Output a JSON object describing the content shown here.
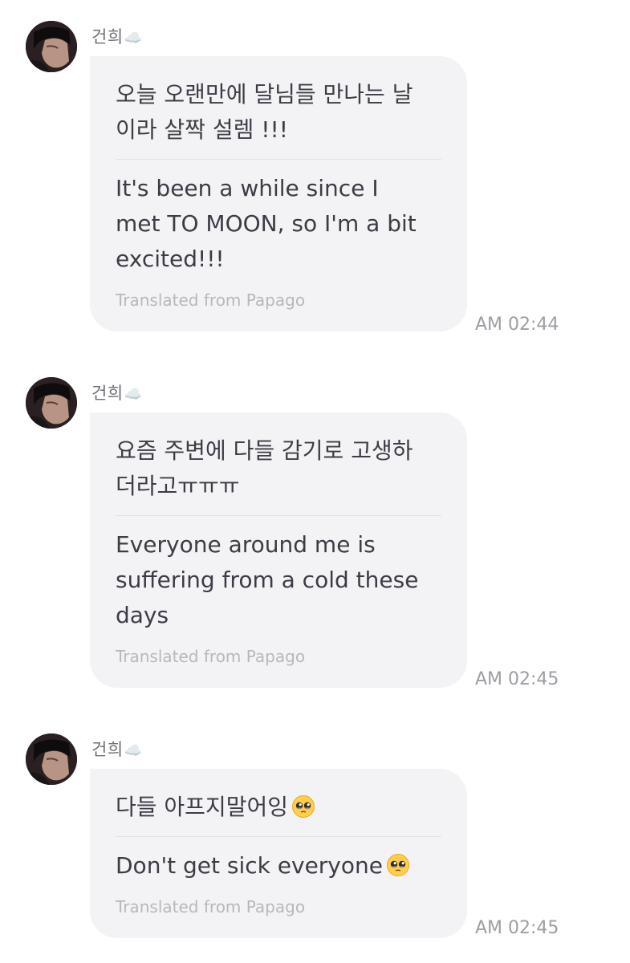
{
  "messages": [
    {
      "sender": "건희",
      "sender_emoji": "☁️",
      "original": "오늘 오랜만에 달님들 만나는 날\n이라 살짝 설렘 !!!",
      "translated": "It's been a while since I\nmet TO MOON, so I'm a bit\nexcited!!!",
      "source": "Translated from Papago",
      "time": "AM 02:44"
    },
    {
      "sender": "건희",
      "sender_emoji": "☁️",
      "original": "요즘 주변에 다들 감기로 고생하\n더라고ㅠㅠㅠ",
      "translated": "Everyone around me is\nsuffering from a cold these\ndays",
      "source": "Translated from Papago",
      "time": "AM 02:45"
    },
    {
      "sender": "건희",
      "sender_emoji": "☁️",
      "original": "다들 아프지말어잉",
      "translated": "Don't get sick everyone",
      "source": "Translated from Papago",
      "time": "AM 02:45",
      "emoji": "pleading-face-icon"
    }
  ],
  "colors": {
    "bubble": "#f3f3f5",
    "text": "#3c3c46",
    "muted": "#b7b7bd",
    "time": "#9d9da4"
  }
}
